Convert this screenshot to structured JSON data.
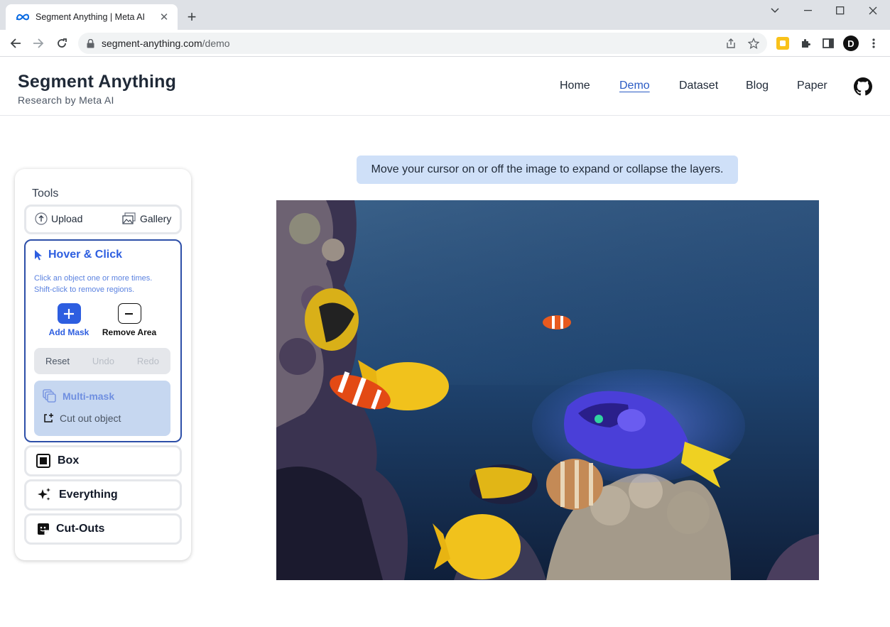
{
  "browser": {
    "tab_title": "Segment Anything | Meta AI",
    "url_host": "segment-anything.com",
    "url_path": "/demo",
    "profile_initial": "D"
  },
  "site": {
    "title": "Segment Anything",
    "subtitle": "Research by Meta AI",
    "nav": [
      "Home",
      "Demo",
      "Dataset",
      "Blog",
      "Paper"
    ],
    "active_nav": "Demo"
  },
  "hint": "Move your cursor on or off the image to expand or collapse the layers.",
  "tools": {
    "label": "Tools",
    "upload": "Upload",
    "gallery": "Gallery",
    "hover_click": {
      "title": "Hover & Click",
      "desc_line1": "Click an object one or more times.",
      "desc_line2": "Shift-click to remove regions.",
      "add_mask": "Add Mask",
      "remove_area": "Remove Area",
      "reset": "Reset",
      "undo": "Undo",
      "redo": "Redo",
      "multi_mask": "Multi-mask",
      "cut_out": "Cut out object"
    },
    "box": "Box",
    "everything": "Everything",
    "cutouts": "Cut-Outs"
  },
  "colors": {
    "accent": "#2d5ee0",
    "hint_bg": "#cfe0f8",
    "mask_highlight": "#5a3cf0"
  }
}
